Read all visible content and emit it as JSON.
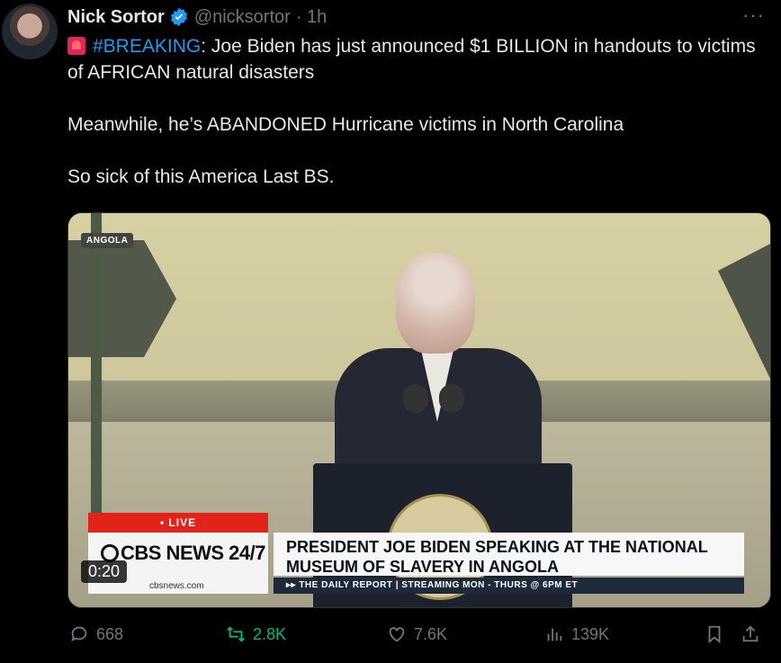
{
  "tweet": {
    "author_name": "Nick Sortor",
    "handle": "@nicksortor",
    "time": "· 1h",
    "more": "···",
    "hashtag": "#BREAKING",
    "line1_rest": ": Joe Biden has just announced $1 BILLION in handouts to victims of AFRICAN natural disasters",
    "para2": "Meanwhile, he’s ABANDONED Hurricane victims in North Carolina",
    "para3": "So sick of this America Last BS."
  },
  "video": {
    "location_tag": "ANGOLA",
    "live_label": "• LIVE",
    "brand": "CBS NEWS 24/7",
    "url": "cbsnews.com",
    "headline": "PRESIDENT JOE BIDEN SPEAKING AT THE NATIONAL MUSEUM OF SLAVERY IN ANGOLA",
    "subline": "▸▸ THE DAILY REPORT | STREAMING MON - THURS @ 6PM ET",
    "timer": "0:20"
  },
  "actions": {
    "replies": "668",
    "reposts": "2.8K",
    "likes": "7.6K",
    "views": "139K"
  },
  "colors": {
    "background": "#000000",
    "text": "#e7e9ea",
    "muted": "#71767b",
    "link": "#1d9bf0",
    "repost": "#00ba7c",
    "verified": "#1d9bf0",
    "live_red": "#e2231a"
  },
  "icons": [
    "verified-badge-icon",
    "siren-icon",
    "reply-icon",
    "repost-icon",
    "like-icon",
    "views-icon",
    "bookmark-icon",
    "share-icon"
  ]
}
